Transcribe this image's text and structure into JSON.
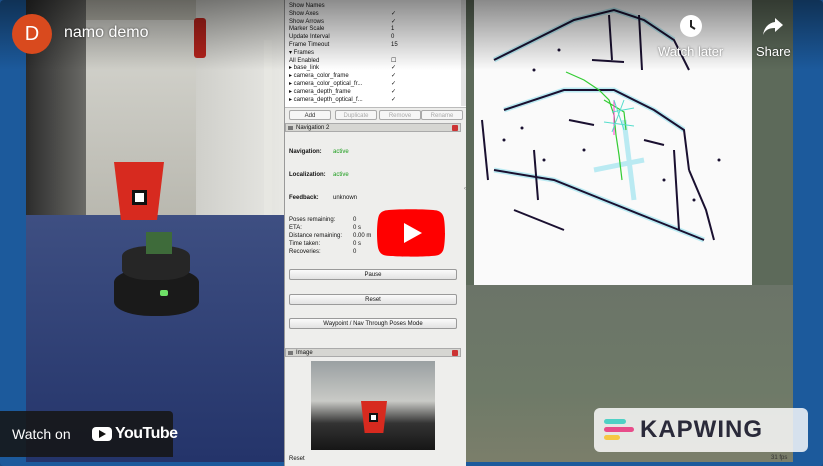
{
  "video": {
    "channel_initial": "D",
    "title": "namo demo",
    "watch_later_label": "Watch later",
    "share_label": "Share",
    "watch_on_label": "Watch on",
    "youtube_brand": "YouTube",
    "watermark": "KAPWING",
    "colors": {
      "avatar": "#d94a1e",
      "play_button": "#ff0000",
      "frame": "#1c5a9c"
    }
  },
  "rviz": {
    "display_tree": [
      {
        "name": "Show Names",
        "value": ""
      },
      {
        "name": "Show Axes",
        "value": "✓"
      },
      {
        "name": "Show Arrows",
        "value": "✓"
      },
      {
        "name": "Marker Scale",
        "value": "1"
      },
      {
        "name": "Update Interval",
        "value": "0"
      },
      {
        "name": "Frame Timeout",
        "value": "15"
      },
      {
        "name": "▾ Frames",
        "value": ""
      },
      {
        "name": "   All Enabled",
        "value": "☐"
      },
      {
        "name": "  ▸ base_link",
        "value": "✓"
      },
      {
        "name": "  ▸ camera_color_frame",
        "value": "✓"
      },
      {
        "name": "  ▸ camera_color_optical_fr...",
        "value": "✓"
      },
      {
        "name": "  ▸ camera_depth_frame",
        "value": "✓"
      },
      {
        "name": "  ▸ camera_depth_optical_f...",
        "value": "✓"
      }
    ],
    "tree_buttons": [
      "Add",
      "Duplicate",
      "Remove",
      "Rename"
    ],
    "navigation_panel": {
      "title": "Navigation 2",
      "navigation_label": "Navigation:",
      "navigation_status": "active",
      "localization_label": "Localization:",
      "localization_status": "active",
      "feedback_label": "Feedback:",
      "feedback_status": "unknown",
      "metrics": [
        {
          "label": "Poses remaining:",
          "value": "0"
        },
        {
          "label": "ETA:",
          "value": "0 s"
        },
        {
          "label": "Distance remaining:",
          "value": "0.00 m"
        },
        {
          "label": "Time taken:",
          "value": "0 s"
        },
        {
          "label": "Recoveries:",
          "value": "0"
        }
      ],
      "pause_label": "Pause",
      "reset_label": "Reset",
      "waypoint_label": "Waypoint / Nav Through Poses Mode"
    },
    "image_panel": {
      "title": "Image"
    },
    "status_reset": "Reset",
    "fps": "31 fps"
  }
}
